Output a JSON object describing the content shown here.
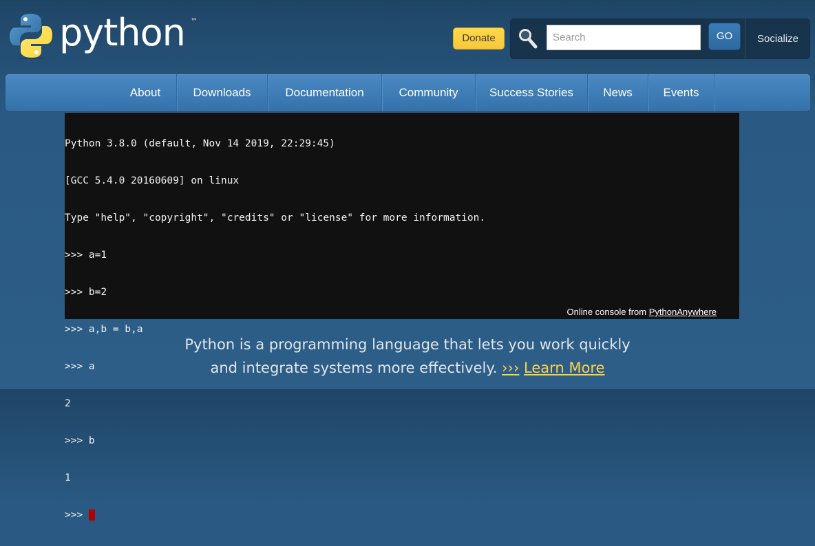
{
  "header": {
    "logo_text": "python",
    "logo_tm": "™",
    "donate_label": "Donate",
    "search": {
      "placeholder": "Search",
      "value": "",
      "icon": "search-icon"
    },
    "go_label": "GO",
    "socialize_label": "Socialize"
  },
  "nav": {
    "items": [
      {
        "label": "About"
      },
      {
        "label": "Downloads"
      },
      {
        "label": "Documentation"
      },
      {
        "label": "Community"
      },
      {
        "label": "Success Stories"
      },
      {
        "label": "News"
      },
      {
        "label": "Events"
      }
    ]
  },
  "console": {
    "lines": [
      "Python 3.8.0 (default, Nov 14 2019, 22:29:45)",
      "[GCC 5.4.0 20160609] on linux",
      "Type \"help\", \"copyright\", \"credits\" or \"license\" for more information.",
      ">>> a=1",
      ">>> b=2",
      ">>> a,b = b,a",
      ">>> a",
      "2",
      ">>> b",
      "1"
    ],
    "prompt": ">>> ",
    "footer_text": "Online console from ",
    "footer_link": "PythonAnywhere"
  },
  "intro": {
    "line1": "Python is a programming language that lets you work quickly",
    "line2": "and integrate systems more effectively.",
    "arrows": "›››",
    "learn_more": "Learn More"
  },
  "colors": {
    "background": "#2b5b84",
    "nav": "#3f7db6",
    "donate": "#ffd343",
    "accent_yellow": "#ffd343",
    "console_bg": "#111111",
    "cursor": "#b20000"
  }
}
